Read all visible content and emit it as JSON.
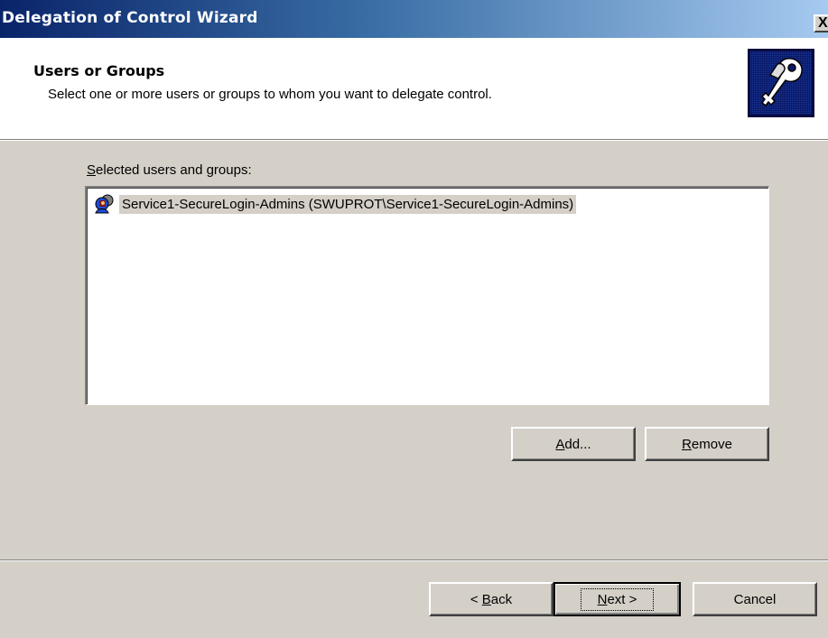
{
  "window": {
    "title": "Delegation of Control Wizard",
    "close_glyph": "X"
  },
  "header": {
    "title": "Users or Groups",
    "subtitle": "Select one or more users or groups to whom you want to delegate control.",
    "icon": "keys-icon"
  },
  "selection": {
    "label_mnemonic": "S",
    "label_rest": "elected users and groups:",
    "items": [
      {
        "label": "Service1-SecureLogin-Admins (SWUPROT\\Service1-SecureLogin-Admins)",
        "icon": "user-group-icon",
        "selected": true
      }
    ]
  },
  "buttons": {
    "add_mnemonic": "A",
    "add_rest": "dd...",
    "remove_mnemonic": "R",
    "remove_rest": "emove",
    "back_prefix": "< ",
    "back_mnemonic": "B",
    "back_rest": "ack",
    "next_mnemonic": "N",
    "next_rest": "ext >",
    "cancel": "Cancel"
  },
  "colors": {
    "titlebar_start": "#0a246a",
    "titlebar_end": "#a6caf0",
    "face": "#d4d0c8"
  }
}
